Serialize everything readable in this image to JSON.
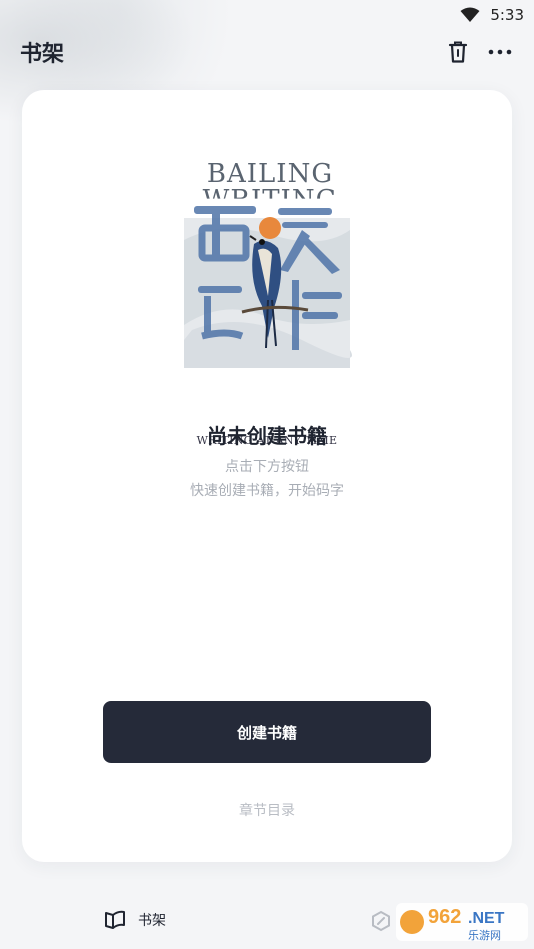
{
  "status_bar": {
    "time": "5:33",
    "wifi_icon": "wifi-icon"
  },
  "header": {
    "title": "书架",
    "delete_icon": "trash-icon",
    "more_icon": "more-icon"
  },
  "cover": {
    "title_line1": "BAILING",
    "title_line2": "WRITING",
    "cn_title": "百灵创作",
    "tagline": "WRITING AT ANY TIME"
  },
  "empty_state": {
    "title": "尚未创建书籍",
    "line1": "点击下方按钮",
    "line2": "快速创建书籍，开始码字"
  },
  "actions": {
    "create_button": "创建书籍",
    "chapter_link": "章节目录"
  },
  "bottom_nav": {
    "items": [
      {
        "label": "书架",
        "icon": "book-open-icon"
      },
      {
        "label": "",
        "icon": "pen-icon"
      }
    ]
  },
  "watermark": {
    "text": "962.NET",
    "subtext": "乐游网"
  },
  "colors": {
    "button_bg": "#252a39",
    "title_text": "#1f2430",
    "muted_text": "#a8adb5",
    "card_bg": "#ffffff",
    "page_bg": "#f4f5f7"
  }
}
